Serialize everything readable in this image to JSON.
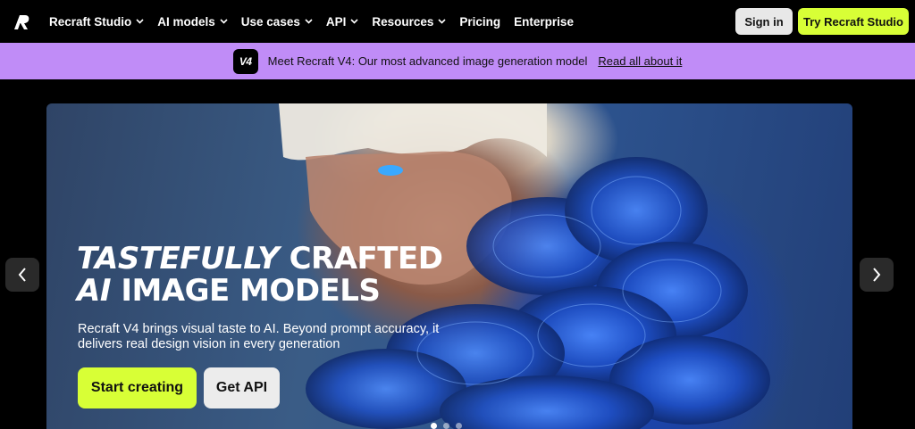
{
  "nav": {
    "logo_icon": "recraft-logo-icon",
    "items": [
      {
        "label": "Recraft Studio",
        "dropdown": true
      },
      {
        "label": "AI models",
        "dropdown": true
      },
      {
        "label": "Use cases",
        "dropdown": true
      },
      {
        "label": "API",
        "dropdown": true
      },
      {
        "label": "Resources",
        "dropdown": true
      },
      {
        "label": "Pricing",
        "dropdown": false
      },
      {
        "label": "Enterprise",
        "dropdown": false
      }
    ],
    "sign_in_label": "Sign in",
    "try_label": "Try Recraft Studio"
  },
  "banner": {
    "badge": "V4",
    "text": "Meet Recraft V4: Our most advanced image generation model",
    "link": "Read all about it"
  },
  "hero": {
    "title_line1_italic": "TASTEFULLY",
    "title_line1_rest": "CRAFTED",
    "title_line2_italic": "AI",
    "title_line2_rest": "IMAGE MODELS",
    "subtitle": "Recraft V4 brings visual taste to AI. Beyond prompt accuracy, it delivers real design vision in every generation",
    "primary_cta": "Start creating",
    "secondary_cta": "Get API",
    "carousel_dots": 3,
    "active_dot": 0
  },
  "colors": {
    "accent": "#d8ff36",
    "banner": "#c08cf7",
    "background": "#000000"
  }
}
